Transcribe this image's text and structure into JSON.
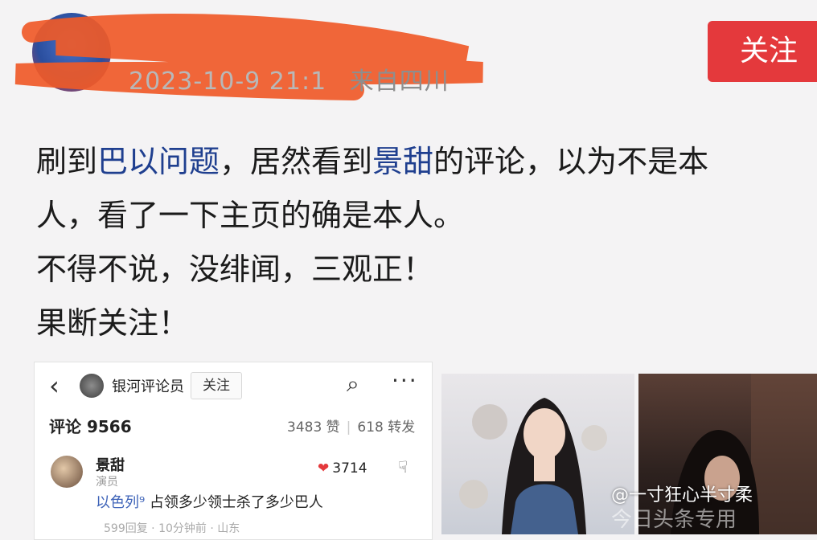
{
  "header": {
    "date_obscured": "2023-10-9 21:1",
    "location": "来自四川",
    "follow_label": "关注"
  },
  "post": {
    "line1_a": "刷到",
    "line1_link1": "巴以问题",
    "line1_b": "，居然看到",
    "line1_link2": "景甜",
    "line1_c": "的评论，以为不是本",
    "line2": "人，看了一下主页的确是本人。",
    "line3": "不得不说，没绯闻，三观正！",
    "line4": "果断关注！"
  },
  "embedded": {
    "back_icon": "‹",
    "username": "银河评论员",
    "follow_label": "关注",
    "comments_label": "评论 9566",
    "likes_stat": "3483 赞",
    "reposts_stat": "618 转发",
    "comment": {
      "name": "景甜",
      "role": "演员",
      "likes": "3714",
      "tag": "以色列",
      "text": "占领多少领士杀了多少巴人",
      "footer": "599回复 · 10分钟前 · 山东"
    }
  },
  "watermark": {
    "text": "@一寸狂心半寸柔",
    "text2": "今日头条专用"
  },
  "colors": {
    "accent_red": "#e4393c",
    "link_blue": "#1f3f8f"
  }
}
